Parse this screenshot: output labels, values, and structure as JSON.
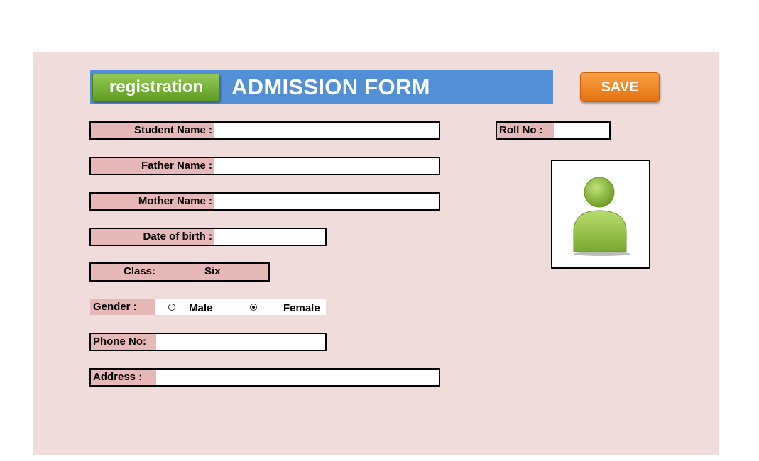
{
  "form": {
    "registration_label": "registration",
    "title": "ADMISSION FORM",
    "save_label": "SAVE",
    "fields": {
      "student_name": {
        "label": "Student Name :",
        "value": ""
      },
      "father_name": {
        "label": "Father Name :",
        "value": ""
      },
      "mother_name": {
        "label": "Mother Name :",
        "value": ""
      },
      "dob": {
        "label": "Date of birth :",
        "value": ""
      },
      "roll_no": {
        "label": "Roll No :",
        "value": ""
      },
      "class": {
        "label": "Class:",
        "value": "Six"
      },
      "gender": {
        "label": "Gender :",
        "options": [
          "Male",
          "Female"
        ],
        "selected": "Female"
      },
      "phone": {
        "label": "Phone No:",
        "value": ""
      },
      "address": {
        "label": "Address :",
        "value": ""
      }
    },
    "photo": {
      "icon": "user-placeholder-icon"
    }
  },
  "colors": {
    "form_background": "#f1dcdc",
    "header_blue": "#538fd6",
    "label_pink": "#e6b8b7",
    "registration_green": "#7ab53c",
    "save_orange": "#f28a26"
  }
}
